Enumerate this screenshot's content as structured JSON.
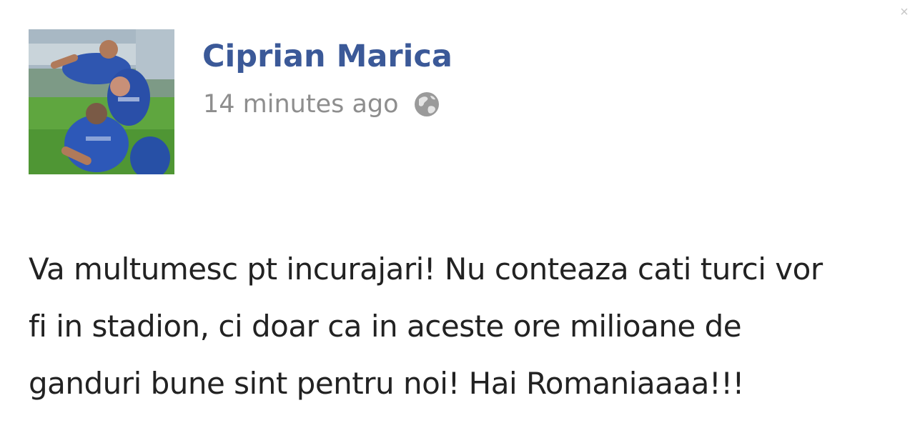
{
  "post": {
    "author": "Ciprian Marica",
    "timestamp": "14 minutes ago",
    "privacy_icon": "globe-icon",
    "message": "Va multumesc pt incurajari! Nu conteaza cati turci vor\nfi in stadion, ci doar ca in aceste ore milioane de\nganduri bune sint pentru noi! Hai Romaniaaaa!!!"
  },
  "ui": {
    "close_icon": "close-icon",
    "close_glyph": "×"
  },
  "colors": {
    "author_link": "#3b5998",
    "timestamp": "#8e8e8e",
    "message_text": "#222222"
  }
}
